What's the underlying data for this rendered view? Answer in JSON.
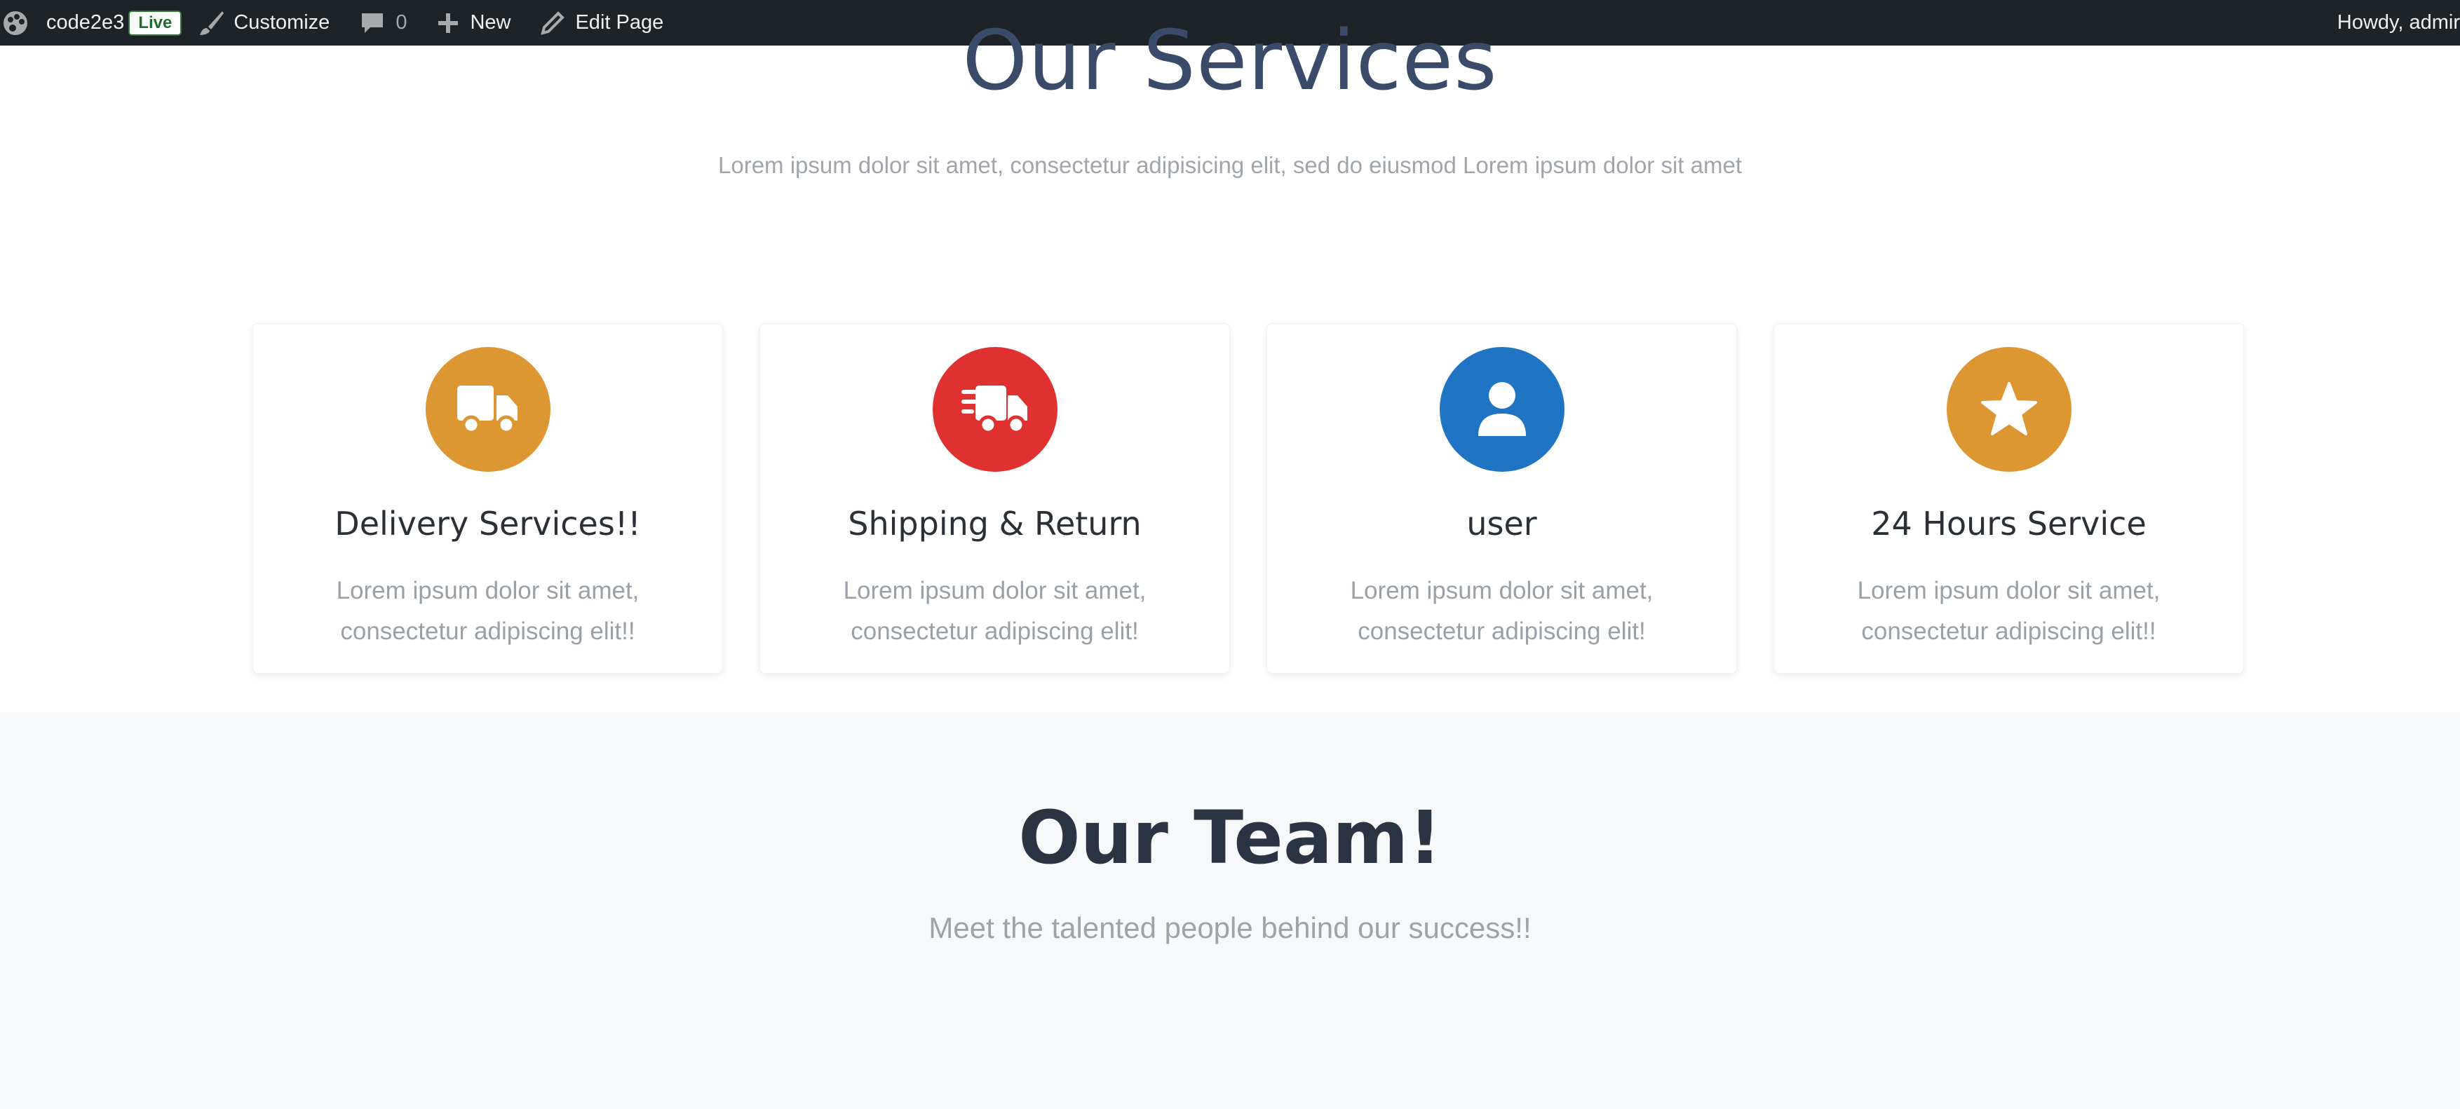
{
  "adminbar": {
    "site_name": "code2e3",
    "live_badge": "Live",
    "customize_label": "Customize",
    "comments_count": "0",
    "new_label": "New",
    "edit_label": "Edit Page",
    "howdy_label": "Howdy, admir"
  },
  "services": {
    "title": "Our Services",
    "subtitle": "Lorem ipsum dolor sit amet, consectetur adipisicing elit, sed do eiusmod Lorem ipsum dolor sit amet",
    "cards": [
      {
        "title": "Delivery Services!!",
        "desc": "Lorem ipsum dolor sit amet, consectetur adipiscing elit!!",
        "icon": "truck-icon",
        "color": "#dc9632"
      },
      {
        "title": "Shipping & Return",
        "desc": "Lorem ipsum dolor sit amet, consectetur adipiscing elit!",
        "icon": "fast-truck-icon",
        "color": "#e03131"
      },
      {
        "title": "user",
        "desc": "Lorem ipsum dolor sit amet, consectetur adipiscing elit!",
        "icon": "user-icon",
        "color": "#1f74c4"
      },
      {
        "title": "24 Hours Service",
        "desc": "Lorem ipsum dolor sit amet, consectetur adipiscing elit!!",
        "icon": "star-icon",
        "color": "#dc9632"
      }
    ]
  },
  "team": {
    "title": "Our Team!",
    "subtitle": "Meet the talented people behind our success!!"
  }
}
